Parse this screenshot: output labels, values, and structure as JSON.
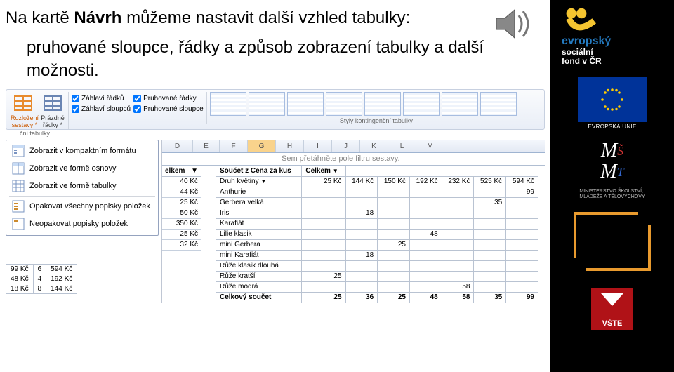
{
  "title": {
    "pre": "Na kartě ",
    "bold": "Návrh",
    "post": " můžeme nastavit další vzhled tabulky:"
  },
  "subtitle": "pruhované sloupce, řádky a způsob zobrazení tabulky a další možnosti.",
  "ribbon": {
    "btn1": "Rozložení\nsestavy *",
    "btn2": "Prázdné\nřádky *",
    "chk1": "Záhlaví řádků",
    "chk2": "Záhlaví sloupců",
    "chk3": "Pruhované řádky",
    "chk4": "Pruhované sloupce",
    "stylesLabel": "Styly kontingenční tabulky",
    "leftSection": "ční tabulky"
  },
  "menu": {
    "i1": "Zobrazit v kompaktním formátu",
    "i2": "Zobrazit ve formě osnovy",
    "i3": "Zobrazit ve formě tabulky",
    "i4": "Opakovat všechny popisky položek",
    "i5": "Neopakovat popisky položek"
  },
  "columns": [
    "D",
    "E",
    "F",
    "G",
    "H",
    "I",
    "J",
    "K",
    "L",
    "M"
  ],
  "filterHint": "Sem přetáhněte pole filtru sestavy.",
  "miniTable": {
    "header": "elkem",
    "rows": [
      "40 Kč",
      "44 Kč",
      "25 Kč",
      "50 Kč",
      "350 Kč",
      "25 Kč",
      "32 Kč"
    ]
  },
  "smallTable": {
    "rows": [
      [
        "99 Kč",
        "6",
        "594 Kč"
      ],
      [
        "48 Kč",
        "4",
        "192 Kč"
      ],
      [
        "18 Kč",
        "8",
        "144 Kč"
      ]
    ]
  },
  "pivot": {
    "title1": "Součet z Cena za kus",
    "title2": "Celkem",
    "colHdr": "Druh květiny",
    "drop": "▼",
    "cols": [
      "25 Kč",
      "144 Kč",
      "150 Kč",
      "192 Kč",
      "232 Kč",
      "525 Kč",
      "594 Kč"
    ],
    "rows": [
      {
        "name": "Anthurie",
        "v": [
          "",
          "",
          "",
          "",
          "",
          "",
          "99"
        ]
      },
      {
        "name": "Gerbera velká",
        "v": [
          "",
          "",
          "",
          "",
          "",
          "35",
          ""
        ]
      },
      {
        "name": "Iris",
        "v": [
          "",
          "18",
          "",
          "",
          "",
          "",
          ""
        ]
      },
      {
        "name": "Karafiát",
        "v": [
          "",
          "",
          "",
          "",
          "",
          "",
          ""
        ]
      },
      {
        "name": "Lilie klasik",
        "v": [
          "",
          "",
          "",
          "48",
          "",
          "",
          ""
        ]
      },
      {
        "name": "mini Gerbera",
        "v": [
          "",
          "",
          "25",
          "",
          "",
          "",
          ""
        ]
      },
      {
        "name": "mini Karafiát",
        "v": [
          "",
          "18",
          "",
          "",
          "",
          "",
          ""
        ]
      },
      {
        "name": "Růže klasik dlouhá",
        "v": [
          "",
          "",
          "",
          "",
          "",
          "",
          ""
        ]
      },
      {
        "name": "Růže kratší",
        "v": [
          "25",
          "",
          "",
          "",
          "",
          "",
          ""
        ]
      },
      {
        "name": "Růže modrá",
        "v": [
          "",
          "",
          "",
          "",
          "58",
          "",
          ""
        ]
      }
    ],
    "totalLabel": "Celkový součet",
    "totals": [
      "25",
      "36",
      "25",
      "48",
      "58",
      "35",
      "99"
    ]
  },
  "logos": {
    "esf1": "evropský",
    "esf2": "sociální",
    "esf3": "fond v ČR",
    "eu": "EVROPSKÁ UNIE",
    "ms1": "MINISTERSTVO ŠKOLSTVÍ,",
    "ms2": "MLÁDEŽE A TĚLOVÝCHOVY",
    "vste": "VŠTE"
  }
}
